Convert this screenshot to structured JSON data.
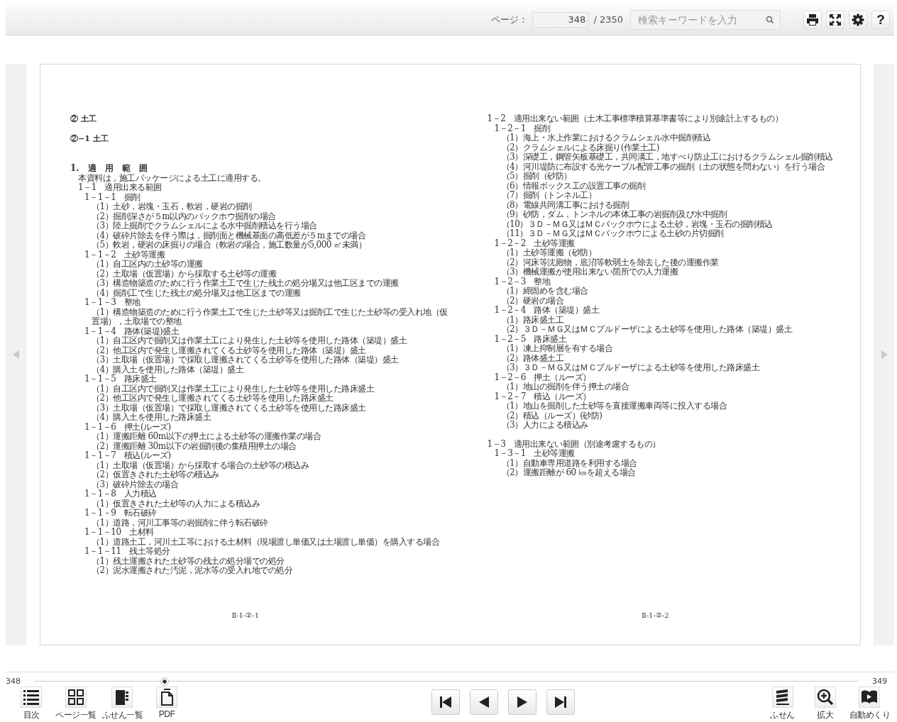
{
  "toolbar": {
    "page_label": "ページ：",
    "page_input": "348",
    "page_total": "/ 2350",
    "search": {
      "placeholder": "検索キーワードを入力"
    },
    "tools": [
      {
        "kind": "print"
      },
      {
        "kind": "fullscreen"
      },
      {
        "kind": "settings"
      },
      {
        "kind": "help",
        "label": "?"
      }
    ]
  },
  "left_page": {
    "headings": [
      "② 土工",
      "②−1 土工"
    ],
    "section": {
      "title": "1.　適　用　範　囲",
      "children": [
        {
          "text": "本資料は，施工パッケージによる土工に適用する。"
        },
        {
          "text": "1－1　適用出来る範囲",
          "children": [
            {
              "text": "1－1－1　掘削",
              "children": [
                {
                  "text": "（1）土砂，岩塊・玉石，軟岩，硬岩の掘削"
                },
                {
                  "text": "（2）掘削深さが５m以内のバックホウ掘削の場合"
                },
                {
                  "text": "（3）陸上掘削でクラムシェルによる水中掘削積込を行う場合"
                },
                {
                  "text": "（4）破砕片除去を伴う際は，掘削面と機械基面の高低差が５mまでの場合"
                },
                {
                  "text": "（5）軟岩，硬岩の床掘りの場合（軟岩の場合，施工数量が5,000 ㎥未満）"
                }
              ]
            },
            {
              "text": "1－1－2　土砂等運搬",
              "children": [
                {
                  "text": "（1）自工区内の土砂等の運搬"
                },
                {
                  "text": "（2）土取場（仮置場）から採取する土砂等の運搬"
                },
                {
                  "text": "（3）構造物築造のために行う作業土工で生じた残土の処分場又は他工区までの運搬"
                },
                {
                  "text": "（4）掘削工で生じた残土の処分場又は他工区までの運搬"
                }
              ]
            },
            {
              "text": "1－1－3　整地",
              "children": [
                {
                  "text": "（1）構造物築造のために行う作業土工で生じた土砂等又は掘削工で生じた土砂等の受入れ地（仮置場），土取場での整地"
                }
              ]
            },
            {
              "text": "1－1－4　路体(築堤)盛土",
              "children": [
                {
                  "text": "（1）自工区内で掘削又は作業土工により発生した土砂等を使用した路体（築堤）盛土"
                },
                {
                  "text": "（2）他工区内で発生し運搬されてくる土砂等を使用した路体（築堤）盛土"
                },
                {
                  "text": "（3）土取場（仮置場）で採取し運搬されてくる土砂等を使用した路体（築堤）盛土"
                },
                {
                  "text": "（4）購入土を使用した路体（築堤）盛土"
                }
              ]
            },
            {
              "text": "1－1－5　路床盛土",
              "children": [
                {
                  "text": "（1）自工区内で掘削又は作業土工により発生した土砂等を使用した路床盛土"
                },
                {
                  "text": "（2）他工区内で発生し運搬されてくる土砂等を使用した路床盛土"
                },
                {
                  "text": "（3）土取場（仮置場）で採取し運搬されてくる土砂等を使用した路床盛土"
                },
                {
                  "text": "（4）購入土を使用した路床盛土"
                }
              ]
            },
            {
              "text": "1－1－6　押土(ルーズ)",
              "children": [
                {
                  "text": "（1）運搬距離 60m以下の押土による土砂等の運搬作業の場合"
                },
                {
                  "text": "（2）運搬距離 30m以下の岩掘削後の集積用押土の場合"
                }
              ]
            },
            {
              "text": "1－1－7　積込(ルーズ)",
              "children": [
                {
                  "text": "（1）土取場（仮置場）から採取する場合の土砂等の積込み"
                },
                {
                  "text": "（2）仮置きされた土砂等の積込み"
                },
                {
                  "text": "（3）破砕片除去の場合"
                }
              ]
            },
            {
              "text": "1－1－8　人力積込",
              "children": [
                {
                  "text": "（1）仮置きされた土砂等の人力による積込み"
                }
              ]
            },
            {
              "text": "1－1－9　転石破砕",
              "children": [
                {
                  "text": "（1）道路，河川工事等の岩掘削に伴う転石破砕"
                }
              ]
            },
            {
              "text": "1－1－10　土材料",
              "children": [
                {
                  "text": "（1）道路土工，河川土工等における土材料（現場渡し単価又は土場渡し単価）を購入する場合"
                }
              ]
            },
            {
              "text": "1－1－11　残土等処分",
              "children": [
                {
                  "text": "（1）残土運搬された土砂等の残土の処分場での処分"
                },
                {
                  "text": "（2）泥水運搬された汚泥，泥水等の受入れ地での処分"
                }
              ]
            }
          ]
        }
      ]
    },
    "page_number": "Ⅱ-1-②-1"
  },
  "right_page": {
    "outline": [
      {
        "text": "1－2　適用出来ない範囲（土木工事標準積算基準書等により別途計上するもの）",
        "children": [
          {
            "text": "1－2－1　掘削",
            "children": [
              {
                "text": "（1）海上・水上作業におけるクラムシェル水中掘削積込"
              },
              {
                "text": "（2）クラムシェルによる床掘り(作業土工)"
              },
              {
                "text": "（3）深礎工，鋼管矢板基礎工，共同溝工，地すべり防止工におけるクラムシェル掘削積込"
              },
              {
                "text": "（4）河川堤防に布設する光ケーブル配管工事の掘削（土の状態を問わない）を行う場合"
              },
              {
                "text": "（5）掘削（砂防）"
              },
              {
                "text": "（6）情報ボックス工の設置工事の掘削"
              },
              {
                "text": "（7）掘削（トンネル工）"
              },
              {
                "text": "（8）電線共同溝工事における掘削"
              },
              {
                "text": "（9）砂防，ダム，トンネルの本体工事の岩掘削及び水中掘削"
              },
              {
                "text": "（10）３Ｄ－ＭＧ又はＭＣバックホウによる土砂，岩塊・玉石の掘削積込"
              },
              {
                "text": "（11）３Ｄ－ＭＧ又はＭＣバックホウによる土砂の片切掘削"
              }
            ]
          },
          {
            "text": "1－2－2　土砂等運搬",
            "children": [
              {
                "text": "（1）土砂等運搬（砂防）"
              },
              {
                "text": "（2）河床等沈殿物，底沼等軟弱土を除去した後の運搬作業"
              },
              {
                "text": "（3）機械運搬が使用出来ない箇所での人力運搬"
              }
            ]
          },
          {
            "text": "1－2－3　整地",
            "children": [
              {
                "text": "（1）締固めを含む場合"
              },
              {
                "text": "（2）硬岩の場合"
              }
            ]
          },
          {
            "text": "1－2－4　路体（築堤）盛土",
            "children": [
              {
                "text": "（1）路床盛土工"
              },
              {
                "text": "（2）３Ｄ－ＭＧ又はＭＣブルドーザによる土砂等を使用した路体（築堤）盛土"
              }
            ]
          },
          {
            "text": "1－2－5　路床盛土",
            "children": [
              {
                "text": "（1）凍上抑制層を有する場合"
              },
              {
                "text": "（2）路体盛土工"
              },
              {
                "text": "（3）３Ｄ－ＭＧ又はＭＣブルドーザによる土砂等を使用した路床盛土"
              }
            ]
          },
          {
            "text": "1－2－6　押土（ルーズ）",
            "children": [
              {
                "text": "（1）地山の掘削を伴う押土の場合"
              }
            ]
          },
          {
            "text": "1－2－7　積込（ルーズ）",
            "children": [
              {
                "text": "（1）地山を掘削した土砂等を直接運搬車両等に投入する場合"
              },
              {
                "text": "（2）積込（ルーズ）(砂防)"
              },
              {
                "text": "（3）人力による積込み"
              }
            ]
          }
        ]
      },
      {
        "text": "1－3　適用出来ない範囲（別途考慮するもの）",
        "children": [
          {
            "text": "1－3－1　土砂等運搬",
            "children": [
              {
                "text": "（1）自動車専用道路を利用する場合"
              },
              {
                "text": "（2）運搬距離が 60 ㎞を超える場合"
              }
            ]
          }
        ]
      }
    ],
    "page_number": "Ⅱ-1-②-2"
  },
  "footer": {
    "current_page": "348",
    "next_page": "349",
    "slider": {
      "level": 0.158
    },
    "left_tools": [
      {
        "kind": "toc",
        "label": "目次"
      },
      {
        "kind": "thumbnails",
        "label": "ページ一覧"
      },
      {
        "kind": "sticky-list",
        "label": "ふせん一覧"
      },
      {
        "kind": "pdf",
        "label": "PDF"
      }
    ],
    "nav": [
      {
        "kind": "first"
      },
      {
        "kind": "prev"
      },
      {
        "kind": "next"
      },
      {
        "kind": "last"
      }
    ],
    "right_tools": [
      {
        "kind": "sticky",
        "label": "ふせん"
      },
      {
        "kind": "zoom",
        "label": "拡大"
      },
      {
        "kind": "autoplay",
        "label": "自動めくり"
      }
    ]
  }
}
